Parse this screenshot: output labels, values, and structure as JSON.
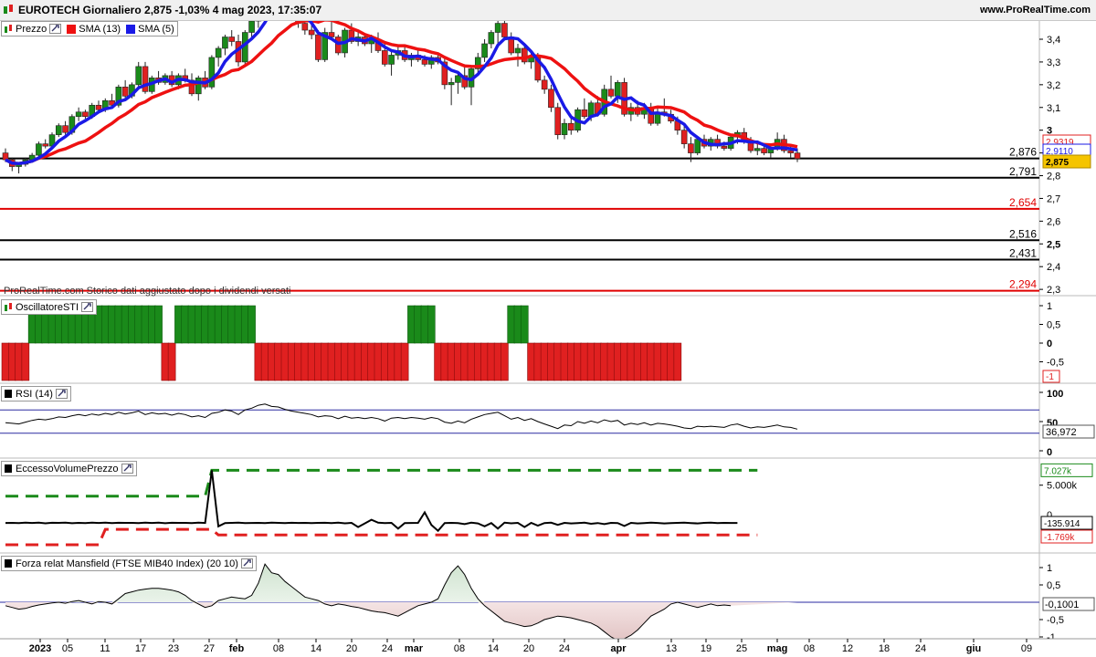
{
  "header": {
    "title": "EUROTECH Giornaliero 2,875 -1,03% 4 mag 2023, 17:35:07",
    "site": "www.ProRealTime.com"
  },
  "price_panel": {
    "legend": {
      "price": "Prezzo",
      "sma13": "SMA (13)",
      "sma5": "SMA (5)"
    },
    "history_note": "ProRealTime.com Storico dati aggiustato dopo i dividendi versati",
    "axis_ticks": [
      "3,4",
      "3,3",
      "3,2",
      "3,1",
      "3",
      "2,9",
      "2,8",
      "2,7",
      "2,6",
      "2,5",
      "2,4",
      "2,3"
    ],
    "badges": {
      "sma13": "2,9319",
      "sma5": "2,9110",
      "last": "2,875"
    },
    "levels": [
      {
        "label": "2,876",
        "value": 2.876,
        "color": "#000000"
      },
      {
        "label": "2,791",
        "value": 2.791,
        "color": "#000000"
      },
      {
        "label": "2,654",
        "value": 2.654,
        "color": "#e00000"
      },
      {
        "label": "2,516",
        "value": 2.516,
        "color": "#000000"
      },
      {
        "label": "2,431",
        "value": 2.431,
        "color": "#000000"
      },
      {
        "label": "2,294",
        "value": 2.294,
        "color": "#e00000"
      }
    ]
  },
  "sti_panel": {
    "legend": "OscillatoreSTI",
    "axis_ticks": [
      "1",
      "0,5",
      "0",
      "-0,5"
    ],
    "badge": "-1"
  },
  "rsi_panel": {
    "legend": "RSI (14)",
    "axis_ticks": [
      "100",
      "50",
      "0"
    ],
    "badge": "36,972",
    "overbought": 70,
    "oversold": 30
  },
  "volume_panel": {
    "legend": "EccessoVolumePrezzo",
    "axis_ticks": [
      "5.000k",
      "0"
    ],
    "badges": {
      "upper": "7.027k",
      "value": "-135.914",
      "lower": "-1.769k"
    }
  },
  "mansfield_panel": {
    "legend": "Forza relat Mansfield (FTSE MIB40 Index) (20 10)",
    "axis_ticks": [
      "1",
      "0,5",
      "-0,5",
      "-1"
    ],
    "badge": "-0,1001"
  },
  "date_axis": [
    "2023",
    "05",
    "11",
    "17",
    "23",
    "27",
    "feb",
    "08",
    "14",
    "20",
    "24",
    "mar",
    "08",
    "14",
    "20",
    "24",
    "apr",
    "13",
    "19",
    "25",
    "mag",
    "08",
    "12",
    "18",
    "24",
    "giu",
    "09"
  ],
  "colors": {
    "up": "#1a8a1a",
    "down": "#e02020",
    "sma13": "#ee1111",
    "sma5": "#1a1ae6"
  },
  "icons": {
    "price": "candlestick-icon",
    "settings": "wrench-icon"
  },
  "chart_data": {
    "type": "candlestick",
    "title": "EUROTECH Giornaliero",
    "x_start": "2023-01-02",
    "candles": [
      [
        2.9,
        2.92,
        2.86,
        2.87
      ],
      [
        2.87,
        2.88,
        2.82,
        2.84
      ],
      [
        2.84,
        2.86,
        2.81,
        2.85
      ],
      [
        2.85,
        2.88,
        2.84,
        2.87
      ],
      [
        2.87,
        2.9,
        2.86,
        2.89
      ],
      [
        2.89,
        2.95,
        2.88,
        2.94
      ],
      [
        2.94,
        2.96,
        2.92,
        2.93
      ],
      [
        2.93,
        2.99,
        2.92,
        2.98
      ],
      [
        2.98,
        3.03,
        2.97,
        3.02
      ],
      [
        3.02,
        3.04,
        2.98,
        2.99
      ],
      [
        2.99,
        3.07,
        2.98,
        3.06
      ],
      [
        3.06,
        3.1,
        3.04,
        3.08
      ],
      [
        3.08,
        3.09,
        3.05,
        3.06
      ],
      [
        3.06,
        3.12,
        3.05,
        3.11
      ],
      [
        3.11,
        3.13,
        3.08,
        3.09
      ],
      [
        3.09,
        3.14,
        3.08,
        3.13
      ],
      [
        3.13,
        3.16,
        3.1,
        3.11
      ],
      [
        3.11,
        3.2,
        3.1,
        3.19
      ],
      [
        3.19,
        3.22,
        3.14,
        3.15
      ],
      [
        3.15,
        3.21,
        3.14,
        3.2
      ],
      [
        3.2,
        3.3,
        3.18,
        3.28
      ],
      [
        3.28,
        3.3,
        3.16,
        3.17
      ],
      [
        3.17,
        3.24,
        3.16,
        3.23
      ],
      [
        3.23,
        3.26,
        3.2,
        3.21
      ],
      [
        3.21,
        3.25,
        3.2,
        3.24
      ],
      [
        3.24,
        3.26,
        3.19,
        3.2
      ],
      [
        3.2,
        3.25,
        3.18,
        3.24
      ],
      [
        3.24,
        3.27,
        3.21,
        3.22
      ],
      [
        3.22,
        3.25,
        3.15,
        3.16
      ],
      [
        3.16,
        3.24,
        3.13,
        3.23
      ],
      [
        3.23,
        3.26,
        3.18,
        3.19
      ],
      [
        3.19,
        3.33,
        3.18,
        3.32
      ],
      [
        3.32,
        3.37,
        3.28,
        3.36
      ],
      [
        3.36,
        3.42,
        3.33,
        3.41
      ],
      [
        3.41,
        3.44,
        3.37,
        3.39
      ],
      [
        3.39,
        3.42,
        3.28,
        3.3
      ],
      [
        3.3,
        3.44,
        3.29,
        3.43
      ],
      [
        3.43,
        3.5,
        3.4,
        3.48
      ],
      [
        3.48,
        3.58,
        3.45,
        3.56
      ],
      [
        3.56,
        3.62,
        3.52,
        3.6
      ],
      [
        3.6,
        3.63,
        3.52,
        3.55
      ],
      [
        3.55,
        3.61,
        3.53,
        3.59
      ],
      [
        3.59,
        3.6,
        3.52,
        3.53
      ],
      [
        3.53,
        3.56,
        3.48,
        3.5
      ],
      [
        3.5,
        3.52,
        3.45,
        3.47
      ],
      [
        3.47,
        3.5,
        3.42,
        3.44
      ],
      [
        3.44,
        3.48,
        3.4,
        3.42
      ],
      [
        3.42,
        3.44,
        3.3,
        3.31
      ],
      [
        3.31,
        3.45,
        3.3,
        3.43
      ],
      [
        3.43,
        3.48,
        3.4,
        3.41
      ],
      [
        3.41,
        3.42,
        3.33,
        3.34
      ],
      [
        3.34,
        3.45,
        3.32,
        3.44
      ],
      [
        3.44,
        3.47,
        3.38,
        3.39
      ],
      [
        3.39,
        3.43,
        3.37,
        3.41
      ],
      [
        3.41,
        3.42,
        3.37,
        3.38
      ],
      [
        3.38,
        3.42,
        3.34,
        3.4
      ],
      [
        3.4,
        3.43,
        3.34,
        3.35
      ],
      [
        3.35,
        3.38,
        3.28,
        3.29
      ],
      [
        3.29,
        3.35,
        3.24,
        3.33
      ],
      [
        3.33,
        3.37,
        3.31,
        3.35
      ],
      [
        3.35,
        3.37,
        3.3,
        3.31
      ],
      [
        3.31,
        3.34,
        3.28,
        3.33
      ],
      [
        3.33,
        3.36,
        3.3,
        3.31
      ],
      [
        3.31,
        3.33,
        3.28,
        3.29
      ],
      [
        3.29,
        3.33,
        3.27,
        3.32
      ],
      [
        3.32,
        3.34,
        3.29,
        3.3
      ],
      [
        3.3,
        3.32,
        3.18,
        3.2
      ],
      [
        3.2,
        3.23,
        3.11,
        3.21
      ],
      [
        3.21,
        3.25,
        3.16,
        3.24
      ],
      [
        3.24,
        3.29,
        3.18,
        3.19
      ],
      [
        3.19,
        3.28,
        3.11,
        3.27
      ],
      [
        3.27,
        3.34,
        3.24,
        3.32
      ],
      [
        3.32,
        3.4,
        3.3,
        3.38
      ],
      [
        3.38,
        3.44,
        3.36,
        3.43
      ],
      [
        3.43,
        3.49,
        3.38,
        3.47
      ],
      [
        3.47,
        3.52,
        3.4,
        3.41
      ],
      [
        3.41,
        3.43,
        3.33,
        3.34
      ],
      [
        3.34,
        3.38,
        3.28,
        3.36
      ],
      [
        3.36,
        3.38,
        3.29,
        3.3
      ],
      [
        3.3,
        3.34,
        3.27,
        3.32
      ],
      [
        3.32,
        3.34,
        3.21,
        3.22
      ],
      [
        3.22,
        3.24,
        3.16,
        3.18
      ],
      [
        3.18,
        3.2,
        3.08,
        3.1
      ],
      [
        3.1,
        3.12,
        2.96,
        2.98
      ],
      [
        2.98,
        3.05,
        2.96,
        3.03
      ],
      [
        3.03,
        3.06,
        2.98,
        3.0
      ],
      [
        3.0,
        3.1,
        2.99,
        3.09
      ],
      [
        3.09,
        3.14,
        3.05,
        3.06
      ],
      [
        3.06,
        3.13,
        3.04,
        3.12
      ],
      [
        3.12,
        3.15,
        3.06,
        3.07
      ],
      [
        3.07,
        3.2,
        3.06,
        3.18
      ],
      [
        3.18,
        3.24,
        3.14,
        3.15
      ],
      [
        3.15,
        3.22,
        3.12,
        3.21
      ],
      [
        3.21,
        3.23,
        3.06,
        3.07
      ],
      [
        3.07,
        3.12,
        3.04,
        3.1
      ],
      [
        3.1,
        3.13,
        3.06,
        3.07
      ],
      [
        3.07,
        3.12,
        3.05,
        3.1
      ],
      [
        3.1,
        3.12,
        3.02,
        3.03
      ],
      [
        3.03,
        3.1,
        3.02,
        3.08
      ],
      [
        3.08,
        3.14,
        3.06,
        3.07
      ],
      [
        3.07,
        3.09,
        3.03,
        3.04
      ],
      [
        3.04,
        3.06,
        2.98,
        3.0
      ],
      [
        3.0,
        3.03,
        2.92,
        2.94
      ],
      [
        2.94,
        2.97,
        2.86,
        2.9
      ],
      [
        2.9,
        2.97,
        2.89,
        2.96
      ],
      [
        2.96,
        2.98,
        2.92,
        2.93
      ],
      [
        2.93,
        2.97,
        2.91,
        2.96
      ],
      [
        2.96,
        2.98,
        2.92,
        2.93
      ],
      [
        2.93,
        2.95,
        2.91,
        2.92
      ],
      [
        2.92,
        2.98,
        2.91,
        2.97
      ],
      [
        2.97,
        3.0,
        2.94,
        2.99
      ],
      [
        2.99,
        3.01,
        2.94,
        2.95
      ],
      [
        2.95,
        2.97,
        2.9,
        2.91
      ],
      [
        2.91,
        2.94,
        2.89,
        2.92
      ],
      [
        2.92,
        2.94,
        2.89,
        2.9
      ],
      [
        2.9,
        2.93,
        2.88,
        2.92
      ],
      [
        2.92,
        2.99,
        2.91,
        2.96
      ],
      [
        2.96,
        2.98,
        2.9,
        2.91
      ],
      [
        2.91,
        2.93,
        2.88,
        2.9
      ],
      [
        2.9,
        2.92,
        2.86,
        2.875
      ]
    ],
    "sti": [
      -1,
      -1,
      -1,
      -1,
      1,
      1,
      1,
      1,
      1,
      1,
      1,
      1,
      1,
      1,
      1,
      1,
      1,
      1,
      1,
      1,
      1,
      1,
      1,
      1,
      -1,
      -1,
      1,
      1,
      1,
      1,
      1,
      1,
      1,
      1,
      1,
      1,
      1,
      1,
      -1,
      -1,
      -1,
      -1,
      -1,
      -1,
      -1,
      -1,
      -1,
      -1,
      -1,
      -1,
      -1,
      -1,
      -1,
      -1,
      -1,
      -1,
      -1,
      -1,
      -1,
      -1,
      -1,
      1,
      1,
      1,
      1,
      -1,
      -1,
      -1,
      -1,
      -1,
      -1,
      -1,
      -1,
      -1,
      -1,
      -1,
      1,
      1,
      1,
      -1,
      -1,
      -1,
      -1,
      -1,
      -1,
      -1,
      -1,
      -1,
      -1,
      -1,
      -1,
      -1,
      -1,
      -1,
      -1,
      -1,
      -1,
      -1,
      -1,
      -1,
      -1,
      -1
    ],
    "rsi": [
      48,
      47,
      46,
      49,
      52,
      54,
      53,
      55,
      58,
      57,
      60,
      62,
      60,
      63,
      61,
      64,
      62,
      66,
      63,
      65,
      68,
      62,
      65,
      63,
      64,
      61,
      64,
      62,
      58,
      60,
      57,
      64,
      66,
      70,
      68,
      62,
      70,
      73,
      78,
      80,
      76,
      75,
      71,
      68,
      66,
      64,
      62,
      58,
      60,
      59,
      55,
      59,
      56,
      57,
      55,
      57,
      55,
      51,
      56,
      57,
      55,
      57,
      56,
      54,
      57,
      55,
      49,
      47,
      51,
      48,
      54,
      58,
      62,
      64,
      66,
      60,
      54,
      57,
      52,
      55,
      50,
      46,
      42,
      38,
      44,
      43,
      50,
      47,
      51,
      48,
      53,
      50,
      52,
      44,
      47,
      45,
      48,
      44,
      47,
      46,
      44,
      42,
      39,
      38,
      42,
      41,
      42,
      41,
      40,
      44,
      46,
      42,
      39,
      41,
      40,
      42,
      44,
      41,
      40,
      37
    ],
    "volume_excess": [
      -135,
      -120,
      -160,
      -90,
      -140,
      -100,
      -180,
      -110,
      -130,
      -90,
      -170,
      -120,
      -150,
      -100,
      -140,
      -90,
      -160,
      -110,
      -130,
      -120,
      -150,
      -100,
      -140,
      -90,
      -170,
      -110,
      -130,
      -120,
      -160,
      -100,
      -140,
      7027,
      -600,
      -150,
      -120,
      -100,
      -160,
      -140,
      -120,
      -150,
      -100,
      -130,
      -160,
      -110,
      -140,
      -120,
      -150,
      -130,
      -110,
      -160,
      -100,
      -180,
      -120,
      -700,
      -200,
      300,
      -100,
      -150,
      -130,
      -900,
      -150,
      -140,
      -120,
      1300,
      -400,
      -1200,
      -150,
      -130,
      -160,
      -300,
      -100,
      -200,
      -600,
      -150,
      -900,
      -100,
      -180,
      -130,
      -700,
      -120,
      -500,
      -150,
      -100,
      -400,
      -120,
      -200,
      -150,
      -100,
      -250,
      -150,
      -300,
      -120,
      -150,
      -550,
      -130,
      -200,
      -150,
      -100,
      -135,
      -200,
      -150,
      -130,
      -100,
      -150,
      -200,
      -130,
      -100,
      -150,
      -120,
      -140,
      -135
    ],
    "volume_upper": [
      3500,
      3500,
      3500,
      3500,
      3500,
      3500,
      3500,
      3500,
      3500,
      3500,
      3500,
      3500,
      3500,
      3500,
      3500,
      3500,
      3500,
      3500,
      3500,
      3500,
      3500,
      3500,
      3500,
      3500,
      3500,
      3500,
      3500,
      3500,
      3500,
      3500,
      3500,
      7027,
      7027,
      7027,
      7027,
      7027,
      7027,
      7027,
      7027,
      7027,
      7027,
      7027,
      7027,
      7027,
      7027,
      7027,
      7027,
      7027,
      7027,
      7027,
      7027,
      7027,
      7027,
      7027,
      7027,
      7027,
      7027,
      7027,
      7027,
      7027,
      7027,
      7027,
      7027,
      7027,
      7027,
      7027,
      7027,
      7027,
      7027,
      7027,
      7027,
      7027,
      7027,
      7027,
      7027,
      7027,
      7027,
      7027,
      7027,
      7027,
      7027,
      7027,
      7027,
      7027,
      7027,
      7027,
      7027,
      7027,
      7027,
      7027,
      7027,
      7027,
      7027,
      7027,
      7027,
      7027,
      7027,
      7027,
      7027,
      7027,
      7027,
      7027,
      7027,
      7027,
      7027,
      7027,
      7027,
      7027,
      7027,
      7027,
      7027,
      7027,
      7027,
      7027
    ],
    "volume_lower": [
      -3100,
      -3100,
      -3100,
      -3100,
      -3100,
      -3100,
      -3100,
      -3100,
      -3100,
      -3100,
      -3100,
      -3100,
      -3100,
      -3100,
      -3100,
      -1000,
      -1000,
      -1000,
      -1000,
      -1000,
      -1000,
      -1000,
      -1000,
      -1000,
      -1000,
      -1000,
      -1000,
      -1000,
      -1000,
      -1000,
      -1000,
      -1000,
      -1769,
      -1769,
      -1769,
      -1769,
      -1769,
      -1769,
      -1769,
      -1769,
      -1769,
      -1769,
      -1769,
      -1769,
      -1769,
      -1769,
      -1769,
      -1769,
      -1769,
      -1769,
      -1769,
      -1769,
      -1769,
      -1769,
      -1769,
      -1769,
      -1769,
      -1769,
      -1769,
      -1769,
      -1769,
      -1769,
      -1769,
      -1769,
      -1769,
      -1769,
      -1769,
      -1769,
      -1769,
      -1769,
      -1769,
      -1769,
      -1769,
      -1769,
      -1769,
      -1769,
      -1769,
      -1769,
      -1769,
      -1769,
      -1769,
      -1769,
      -1769,
      -1769,
      -1769,
      -1769,
      -1769,
      -1769,
      -1769,
      -1769,
      -1769,
      -1769,
      -1769,
      -1769,
      -1769,
      -1769,
      -1769,
      -1769,
      -1769,
      -1769,
      -1769,
      -1769,
      -1769,
      -1769,
      -1769,
      -1769,
      -1769,
      -1769,
      -1769,
      -1769,
      -1769,
      -1769,
      -1769,
      -1769
    ],
    "mansfield": [
      -0.1,
      -0.15,
      -0.2,
      -0.18,
      -0.12,
      -0.08,
      -0.05,
      -0.02,
      0.0,
      -0.03,
      0.02,
      0.05,
      0.0,
      -0.05,
      0.02,
      0.0,
      -0.05,
      0.1,
      0.25,
      0.3,
      0.35,
      0.38,
      0.4,
      0.4,
      0.38,
      0.35,
      0.3,
      0.2,
      0.05,
      -0.05,
      -0.15,
      -0.1,
      0.05,
      0.1,
      0.15,
      0.12,
      0.1,
      0.2,
      0.55,
      1.1,
      0.85,
      0.8,
      0.6,
      0.45,
      0.3,
      0.15,
      0.1,
      0.05,
      -0.05,
      -0.1,
      -0.05,
      -0.08,
      -0.12,
      -0.15,
      -0.2,
      -0.25,
      -0.28,
      -0.3,
      -0.35,
      -0.4,
      -0.3,
      -0.2,
      -0.1,
      -0.05,
      0.0,
      0.1,
      0.5,
      0.85,
      1.05,
      0.8,
      0.4,
      0.1,
      -0.1,
      -0.25,
      -0.4,
      -0.55,
      -0.6,
      -0.65,
      -0.7,
      -0.68,
      -0.6,
      -0.5,
      -0.45,
      -0.4,
      -0.42,
      -0.45,
      -0.5,
      -0.55,
      -0.6,
      -0.7,
      -0.85,
      -1.0,
      -1.1,
      -1.05,
      -0.95,
      -0.8,
      -0.6,
      -0.4,
      -0.3,
      -0.2,
      -0.05,
      0.0,
      -0.05,
      -0.1,
      -0.15,
      -0.1,
      -0.05,
      -0.1,
      -0.08,
      -0.1
    ]
  }
}
